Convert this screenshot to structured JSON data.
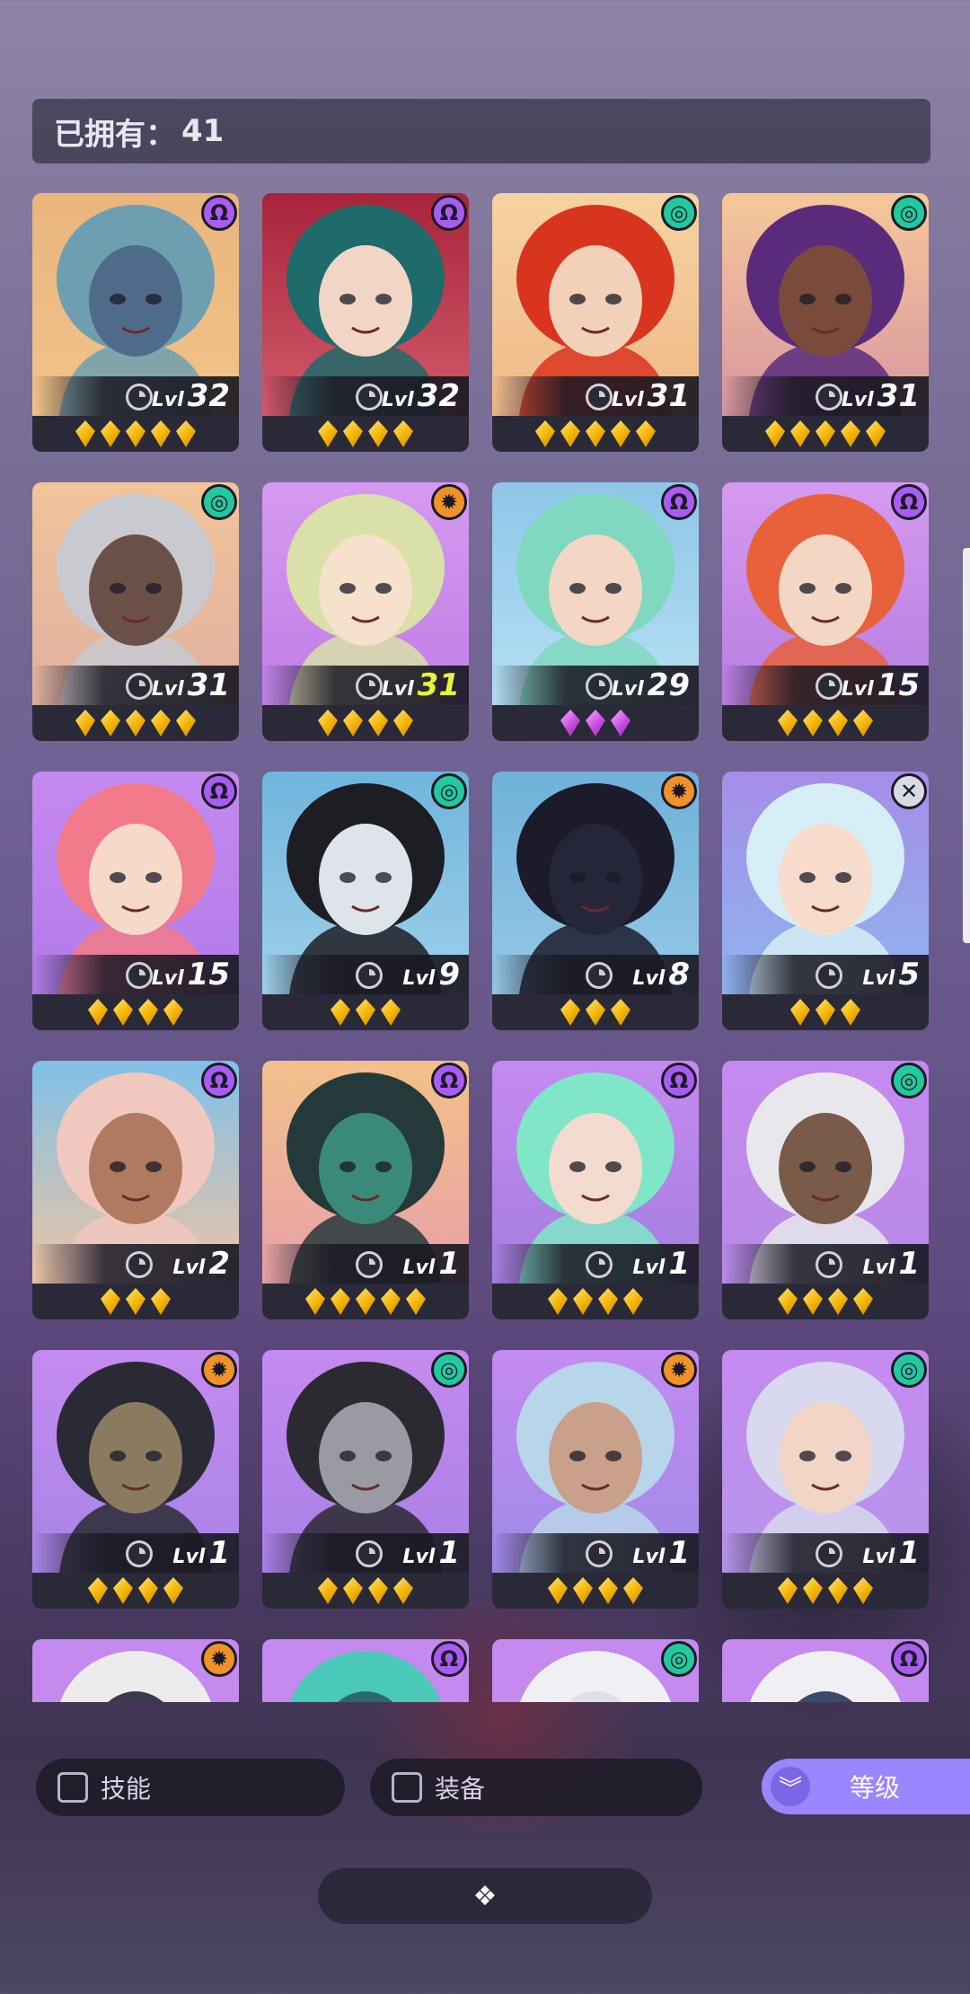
{
  "owned": {
    "label": "已拥有：",
    "count": "41"
  },
  "level_prefix": "Lvl",
  "factions": {
    "purple": {
      "color": "#a95cf2",
      "glyph": "Ω",
      "icon": "omega-faction-icon"
    },
    "green": {
      "color": "#22c9a0",
      "glyph": "◎",
      "icon": "vortex-faction-icon"
    },
    "orange": {
      "color": "#f0922a",
      "glyph": "✹",
      "icon": "sun-faction-icon"
    },
    "silver": {
      "color": "#d8dae6",
      "glyph": "✕",
      "icon": "cross-faction-icon"
    }
  },
  "cards": [
    {
      "level": "32",
      "level_color": "#ffffff",
      "stars": 5,
      "star_type": "gold",
      "faction": "purple",
      "bg": [
        "#e9b57c",
        "#f2c48a"
      ],
      "hair": "#6d9fb0",
      "skin": "#4f6b8a"
    },
    {
      "level": "32",
      "level_color": "#ffffff",
      "stars": 4,
      "star_type": "gold",
      "faction": "purple",
      "bg": [
        "#a8243b",
        "#d35a6a"
      ],
      "hair": "#1f6a6a",
      "skin": "#f1d6c6"
    },
    {
      "level": "31",
      "level_color": "#ffffff",
      "stars": 5,
      "star_type": "gold",
      "faction": "green",
      "bg": [
        "#f5d4a1",
        "#f0b888"
      ],
      "hair": "#d9341e",
      "skin": "#f3d0b8"
    },
    {
      "level": "31",
      "level_color": "#ffffff",
      "stars": 5,
      "star_type": "gold",
      "faction": "green",
      "bg": [
        "#f5c89a",
        "#d896a0"
      ],
      "hair": "#5b2b7b",
      "skin": "#7a4b3a"
    },
    {
      "level": "31",
      "level_color": "#ffffff",
      "stars": 5,
      "star_type": "gold",
      "faction": "green",
      "bg": [
        "#f1c49a",
        "#e0b0a0"
      ],
      "hair": "#c9c9d0",
      "skin": "#6b5048"
    },
    {
      "level": "31",
      "level_color": "#e6f53a",
      "stars": 4,
      "star_type": "gold",
      "faction": "orange",
      "bg": [
        "#d59af0",
        "#c07ee6"
      ],
      "hair": "#d9e0a8",
      "skin": "#f6e1cc"
    },
    {
      "level": "29",
      "level_color": "#ffffff",
      "stars": 3,
      "star_type": "purple",
      "faction": "purple",
      "bg": [
        "#8ec6e8",
        "#b6e0f3"
      ],
      "hair": "#7fd8bf",
      "skin": "#f3d7c4"
    },
    {
      "level": "15",
      "level_color": "#ffffff",
      "stars": 4,
      "star_type": "gold",
      "faction": "purple",
      "bg": [
        "#d59af0",
        "#b77de0"
      ],
      "hair": "#e8613a",
      "skin": "#f3d7c4"
    },
    {
      "level": "15",
      "level_color": "#ffffff",
      "stars": 4,
      "star_type": "gold",
      "faction": "purple",
      "bg": [
        "#c58af0",
        "#b27ae8"
      ],
      "hair": "#f07a8a",
      "skin": "#f6d9c9"
    },
    {
      "level": "9",
      "level_color": "#ffffff",
      "stars": 3,
      "star_type": "gold",
      "faction": "green",
      "bg": [
        "#6fb5dc",
        "#9fd0ea"
      ],
      "hair": "#1d1d24",
      "skin": "#dfe4ea"
    },
    {
      "level": "8",
      "level_color": "#ffffff",
      "stars": 3,
      "star_type": "gold",
      "faction": "orange",
      "bg": [
        "#6fb1d8",
        "#95c8e6"
      ],
      "hair": "#1b1b2c",
      "skin": "#26263a"
    },
    {
      "level": "5",
      "level_color": "#ffffff",
      "stars": 3,
      "star_type": "gold",
      "faction": "silver",
      "bg": [
        "#a68de8",
        "#8fb4ee"
      ],
      "hair": "#d6eef6",
      "skin": "#f7dccd"
    },
    {
      "level": "2",
      "level_color": "#ffffff",
      "stars": 3,
      "star_type": "gold",
      "faction": "purple",
      "bg": [
        "#7fc0e8",
        "#f0c4a4"
      ],
      "hair": "#f0c8c0",
      "skin": "#b07a60"
    },
    {
      "level": "1",
      "level_color": "#ffffff",
      "stars": 5,
      "star_type": "gold",
      "faction": "purple",
      "bg": [
        "#f2c18a",
        "#e8a0a8"
      ],
      "hair": "#243a3a",
      "skin": "#3a8a7a"
    },
    {
      "level": "1",
      "level_color": "#ffffff",
      "stars": 4,
      "star_type": "gold",
      "faction": "purple",
      "bg": [
        "#c58af0",
        "#a47ee0"
      ],
      "hair": "#7fe6c8",
      "skin": "#f3dccf"
    },
    {
      "level": "1",
      "level_color": "#ffffff",
      "stars": 4,
      "star_type": "gold",
      "faction": "green",
      "bg": [
        "#c58af0",
        "#b88ae6"
      ],
      "hair": "#e8e8ec",
      "skin": "#7a5a48"
    },
    {
      "level": "1",
      "level_color": "#ffffff",
      "stars": 4,
      "star_type": "gold",
      "faction": "orange",
      "bg": [
        "#c58af0",
        "#a784e6"
      ],
      "hair": "#2a2a34",
      "skin": "#8a7b60"
    },
    {
      "level": "1",
      "level_color": "#ffffff",
      "stars": 4,
      "star_type": "gold",
      "faction": "green",
      "bg": [
        "#c58af0",
        "#a880e6"
      ],
      "hair": "#2a2a30",
      "skin": "#9a9aa4"
    },
    {
      "level": "1",
      "level_color": "#ffffff",
      "stars": 4,
      "star_type": "gold",
      "faction": "orange",
      "bg": [
        "#c58af0",
        "#9e8ae8"
      ],
      "hair": "#b8d6ea",
      "skin": "#c9a08a"
    },
    {
      "level": "1",
      "level_color": "#ffffff",
      "stars": 4,
      "star_type": "gold",
      "faction": "green",
      "bg": [
        "#c58af0",
        "#b596ea"
      ],
      "hair": "#d8d8ee",
      "skin": "#f1d6c8"
    },
    {
      "level": "",
      "level_color": "#ffffff",
      "stars": 0,
      "star_type": "gold",
      "faction": "orange",
      "bg": [
        "#c58af0",
        "#c08ae8"
      ],
      "hair": "#ececec",
      "skin": "#3a3a4a"
    },
    {
      "level": "",
      "level_color": "#ffffff",
      "stars": 0,
      "star_type": "gold",
      "faction": "purple",
      "bg": [
        "#c58af0",
        "#c08ae8"
      ],
      "hair": "#4ac9b8",
      "skin": "#2a6a6a"
    },
    {
      "level": "",
      "level_color": "#ffffff",
      "stars": 0,
      "star_type": "gold",
      "faction": "green",
      "bg": [
        "#c58af0",
        "#c08ae8"
      ],
      "hair": "#f0f0f4",
      "skin": "#e0e0e8"
    },
    {
      "level": "",
      "level_color": "#ffffff",
      "stars": 0,
      "star_type": "gold",
      "faction": "purple",
      "bg": [
        "#c58af0",
        "#c08ae8"
      ],
      "hair": "#f0f0f4",
      "skin": "#3a4a6a"
    }
  ],
  "filters": {
    "skill": "技能",
    "equipment": "装备"
  },
  "sort": {
    "label": "等级",
    "icon": "double-chevron-down-icon"
  },
  "bottom": {
    "icon": "collapse-diamond-icon",
    "glyph": "❖"
  }
}
